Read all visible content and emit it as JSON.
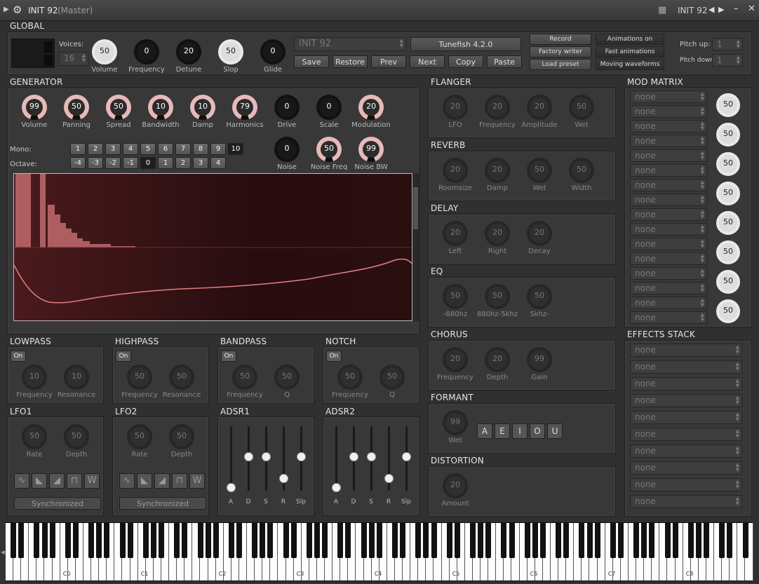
{
  "window": {
    "title": "INIT 92",
    "subtitle": "(Master)",
    "preset_short": "INIT 92"
  },
  "global": {
    "header": "GLOBAL",
    "voices_label": "Voices:",
    "voices_value": "16",
    "knobs": [
      {
        "label": "Volume",
        "value": "50"
      },
      {
        "label": "Frequency",
        "value": "0"
      },
      {
        "label": "Detune",
        "value": "20"
      },
      {
        "label": "Slop",
        "value": "50"
      },
      {
        "label": "Glide",
        "value": "0"
      }
    ],
    "preset_name": "INIT 92",
    "version": "Tunefish 4.2.0",
    "buttons": [
      "Save",
      "Restore",
      "Prev",
      "Next",
      "Copy",
      "Paste"
    ],
    "right_buttons": [
      "Record",
      "Factory writer",
      "Load preset"
    ],
    "anim_buttons": [
      "Animations on",
      "Fast animations",
      "Moving waveforms"
    ],
    "pitch_up_label": "Pitch up:",
    "pitch_up_value": "1",
    "pitch_down_label": "Pitch down:",
    "pitch_down_value": "1"
  },
  "generator": {
    "header": "GENERATOR",
    "knobs": [
      {
        "label": "Volume",
        "value": "99"
      },
      {
        "label": "Panning",
        "value": "50"
      },
      {
        "label": "Spread",
        "value": "50"
      },
      {
        "label": "Bandwidth",
        "value": "10"
      },
      {
        "label": "Damp",
        "value": "10"
      },
      {
        "label": "Harmonics",
        "value": "79"
      },
      {
        "label": "Drive",
        "value": "0"
      },
      {
        "label": "Scale",
        "value": "0"
      },
      {
        "label": "Modulation",
        "value": "20"
      }
    ],
    "mono_label": "Mono:",
    "mono_values": [
      "1",
      "2",
      "3",
      "4",
      "5",
      "6",
      "7",
      "8",
      "9",
      "10"
    ],
    "octave_label": "Octave:",
    "octave_values": [
      "-4",
      "-3",
      "-2",
      "-1",
      "0",
      "1",
      "2",
      "3",
      "4"
    ],
    "noise_knobs": [
      {
        "label": "Noise",
        "value": "0"
      },
      {
        "label": "Noise Freq",
        "value": "50"
      },
      {
        "label": "Noise BW",
        "value": "99"
      }
    ]
  },
  "flanger": {
    "header": "FLANGER",
    "knobs": [
      {
        "label": "LFO",
        "value": "20"
      },
      {
        "label": "Frequency",
        "value": "20"
      },
      {
        "label": "Amplitude",
        "value": "20"
      },
      {
        "label": "Wet",
        "value": "50"
      }
    ]
  },
  "reverb": {
    "header": "REVERB",
    "knobs": [
      {
        "label": "Roomsize",
        "value": "20"
      },
      {
        "label": "Damp",
        "value": "20"
      },
      {
        "label": "Wet",
        "value": "50"
      },
      {
        "label": "Width",
        "value": "50"
      }
    ]
  },
  "delay": {
    "header": "DELAY",
    "knobs": [
      {
        "label": "Left",
        "value": "20"
      },
      {
        "label": "Right",
        "value": "20"
      },
      {
        "label": "Decay",
        "value": "20"
      }
    ]
  },
  "eq": {
    "header": "EQ",
    "knobs": [
      {
        "label": "-880hz",
        "value": "50"
      },
      {
        "label": "880hz-5khz",
        "value": "50"
      },
      {
        "label": "5khz-",
        "value": "50"
      }
    ]
  },
  "chorus": {
    "header": "CHORUS",
    "knobs": [
      {
        "label": "Frequency",
        "value": "20"
      },
      {
        "label": "Depth",
        "value": "20"
      },
      {
        "label": "Gain",
        "value": "99"
      }
    ]
  },
  "formant": {
    "header": "FORMANT",
    "knob": {
      "label": "Wet",
      "value": "99"
    },
    "vowels": [
      "A",
      "E",
      "I",
      "O",
      "U"
    ]
  },
  "distortion": {
    "header": "DISTORTION",
    "knob": {
      "label": "Amount",
      "value": "20"
    }
  },
  "mod_matrix": {
    "header": "MOD MATRIX",
    "slot_text": "none",
    "knob_value": "50"
  },
  "effects_stack": {
    "header": "EFFECTS STACK",
    "slot_text": "none"
  },
  "filters": [
    {
      "header": "LOWPASS",
      "on": "On",
      "knobs": [
        {
          "label": "Frequency",
          "value": "10"
        },
        {
          "label": "Resonance",
          "value": "10"
        }
      ]
    },
    {
      "header": "HIGHPASS",
      "on": "On",
      "knobs": [
        {
          "label": "Frequency",
          "value": "50"
        },
        {
          "label": "Resonance",
          "value": "50"
        }
      ]
    },
    {
      "header": "BANDPASS",
      "on": "On",
      "knobs": [
        {
          "label": "Frequency",
          "value": "50"
        },
        {
          "label": "Q",
          "value": "50"
        }
      ]
    },
    {
      "header": "NOTCH",
      "on": "On",
      "knobs": [
        {
          "label": "Frequency",
          "value": "50"
        },
        {
          "label": "Q",
          "value": "50"
        }
      ]
    }
  ],
  "lfos": [
    {
      "header": "LFO1",
      "knobs": [
        {
          "label": "Rate",
          "value": "50"
        },
        {
          "label": "Depth",
          "value": "50"
        }
      ],
      "sync": "Synchronized"
    },
    {
      "header": "LFO2",
      "knobs": [
        {
          "label": "Rate",
          "value": "50"
        },
        {
          "label": "Depth",
          "value": "50"
        }
      ],
      "sync": "Synchronized"
    }
  ],
  "adsrs": [
    {
      "header": "ADSR1",
      "labels": [
        "A",
        "D",
        "S",
        "R",
        "Slp"
      ],
      "levels": [
        0.05,
        0.53,
        0.53,
        0.2,
        0.53
      ]
    },
    {
      "header": "ADSR2",
      "labels": [
        "A",
        "D",
        "S",
        "R",
        "Slp"
      ],
      "levels": [
        0.05,
        0.53,
        0.53,
        0.2,
        0.53
      ]
    }
  ],
  "piano": {
    "octaves": [
      "C0",
      "C1",
      "C2",
      "C3",
      "C4",
      "C5",
      "C6",
      "C7",
      "C8"
    ]
  },
  "colors": {
    "accent_pink": "#e8b9b9",
    "display_bg": "#3a1517",
    "curve": "#e07f82"
  }
}
